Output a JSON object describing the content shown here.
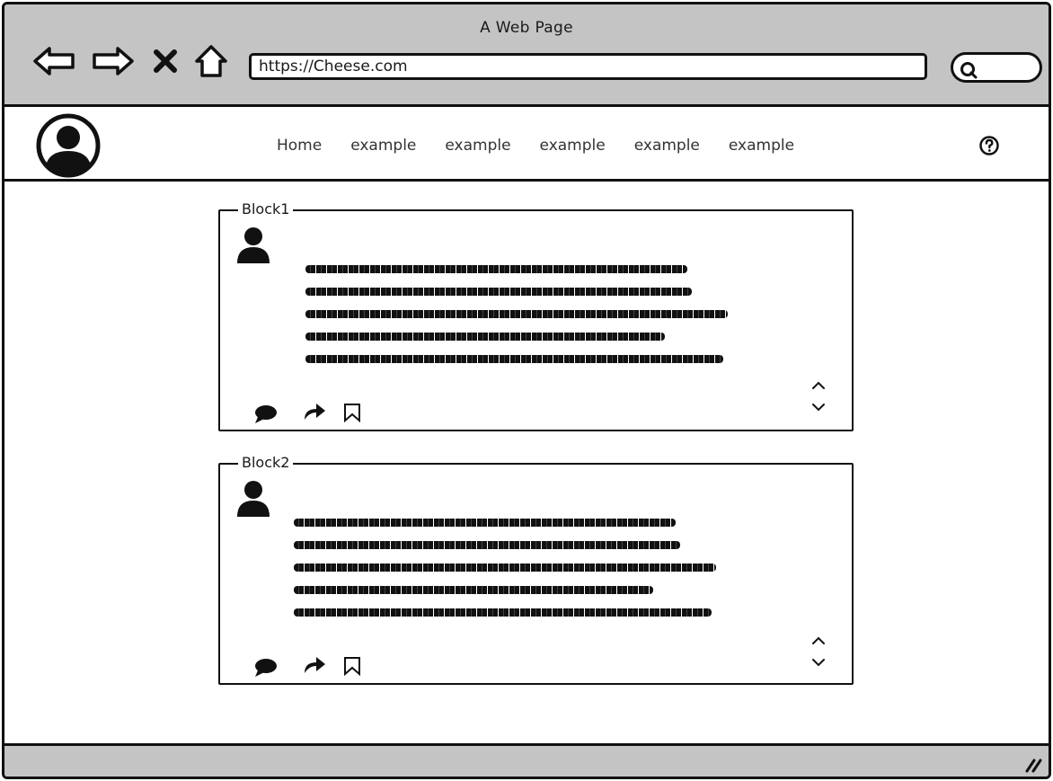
{
  "window": {
    "title": "A Web Page"
  },
  "browser": {
    "address": "https://Cheese.com",
    "nav_icons": [
      "back-arrow-icon",
      "forward-arrow-icon",
      "close-icon",
      "home-icon"
    ],
    "search_icon": "search-icon"
  },
  "header": {
    "avatar_icon": "user-circle-icon",
    "nav": [
      "Home",
      "example",
      "example",
      "example",
      "example",
      "example"
    ],
    "help_icon": "help-icon"
  },
  "blocks": [
    {
      "title": "Block1",
      "user_icon": "user-icon",
      "actions": [
        "comment-icon",
        "share-icon",
        "bookmark-icon"
      ],
      "vote_icons": [
        "chevron-up-icon",
        "chevron-down-icon"
      ]
    },
    {
      "title": "Block2",
      "user_icon": "user-icon",
      "actions": [
        "comment-icon",
        "share-icon",
        "bookmark-icon"
      ],
      "vote_icons": [
        "chevron-up-icon",
        "chevron-down-icon"
      ]
    }
  ],
  "status_bar": {
    "grip_icon": "resize-grip-icon"
  }
}
